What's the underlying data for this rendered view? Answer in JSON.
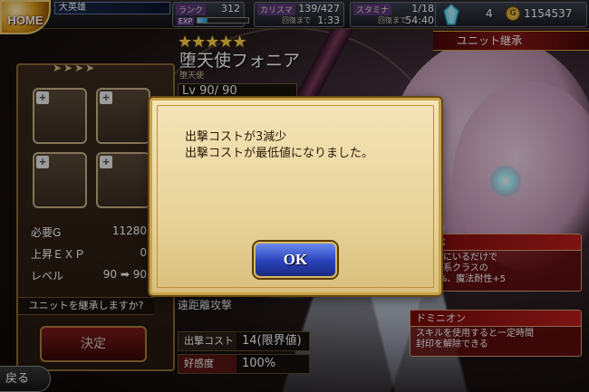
{
  "topbar": {
    "home_label": "HOME",
    "player_name": "大英雄",
    "rank_label": "ランク",
    "rank_value": "312",
    "exp_label": "EXP",
    "exp_fill": 0.2,
    "charisma_label": "カリスマ",
    "charisma_value": "139/427",
    "charisma_recover_label": "回復まで",
    "charisma_recover_time": "1:33",
    "stamina_label": "スタミナ",
    "stamina_value": "1/18",
    "stamina_recover_label": "回復まで",
    "stamina_recover_time": "54:40",
    "crystal_count": "4",
    "gold_count": "1154537"
  },
  "section_title": "ユニット継承",
  "left_panel": {
    "required_gold_label": "必要G",
    "required_gold_value": "11280",
    "exp_gain_label": "上昇ＥＸＰ",
    "exp_gain_value": "0",
    "level_label": "レベル",
    "level_change": "90 ➡ 90",
    "confirm_question": "ユニットを継承しますか?",
    "decide_button": "決定"
  },
  "unit": {
    "stars": "★★★★★",
    "name": "堕天使フォニア",
    "class": "堕天使",
    "level": "Lv 90/ 90",
    "attack_type": "遠距離攻撃",
    "cost_label": "出撃コスト",
    "cost_value": "14(限界値)",
    "affection_label": "好感度",
    "affection_value": "100%"
  },
  "skills": [
    {
      "head": "の調べ",
      "body": "ンバーにいるだけで\nジェル系クラスの\nカ+5%、魔法耐性+5"
    },
    {
      "head": "ドミニオン",
      "body": "スキルを使用すると一定時間\n封印を解除できる"
    }
  ],
  "back_button": "戻る",
  "modal": {
    "line1": "出撃コストが3減少",
    "line2": "出撃コストが最低値になりました。",
    "ok_label": "OK"
  },
  "colors": {
    "accent_red": "#8a1616",
    "modal_parchment": "#e8d39a",
    "ok_blue": "#2a40b8",
    "star_gold": "#ffd84a"
  }
}
